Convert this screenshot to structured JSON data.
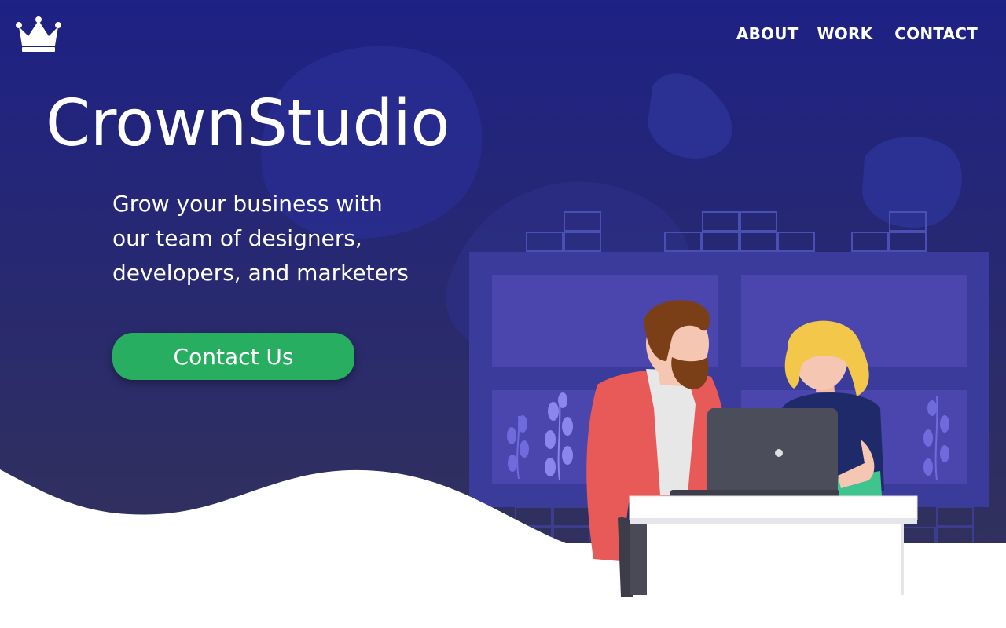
{
  "colors": {
    "background_top": "#1e2185",
    "background_bottom": "#343357",
    "accent_green": "#27ae60",
    "text": "#ffffff"
  },
  "logo": {
    "icon": "crown-icon"
  },
  "nav": {
    "items": [
      "ABOUT",
      "WORK",
      "CONTACT"
    ]
  },
  "hero": {
    "title": "CrownStudio",
    "tagline_lines": [
      "Grow your business with",
      "our team of designers,",
      "developers, and marketers"
    ],
    "cta_label": "Contact Us"
  },
  "illustration": {
    "subject": "two-people-at-laptop-illustration"
  }
}
